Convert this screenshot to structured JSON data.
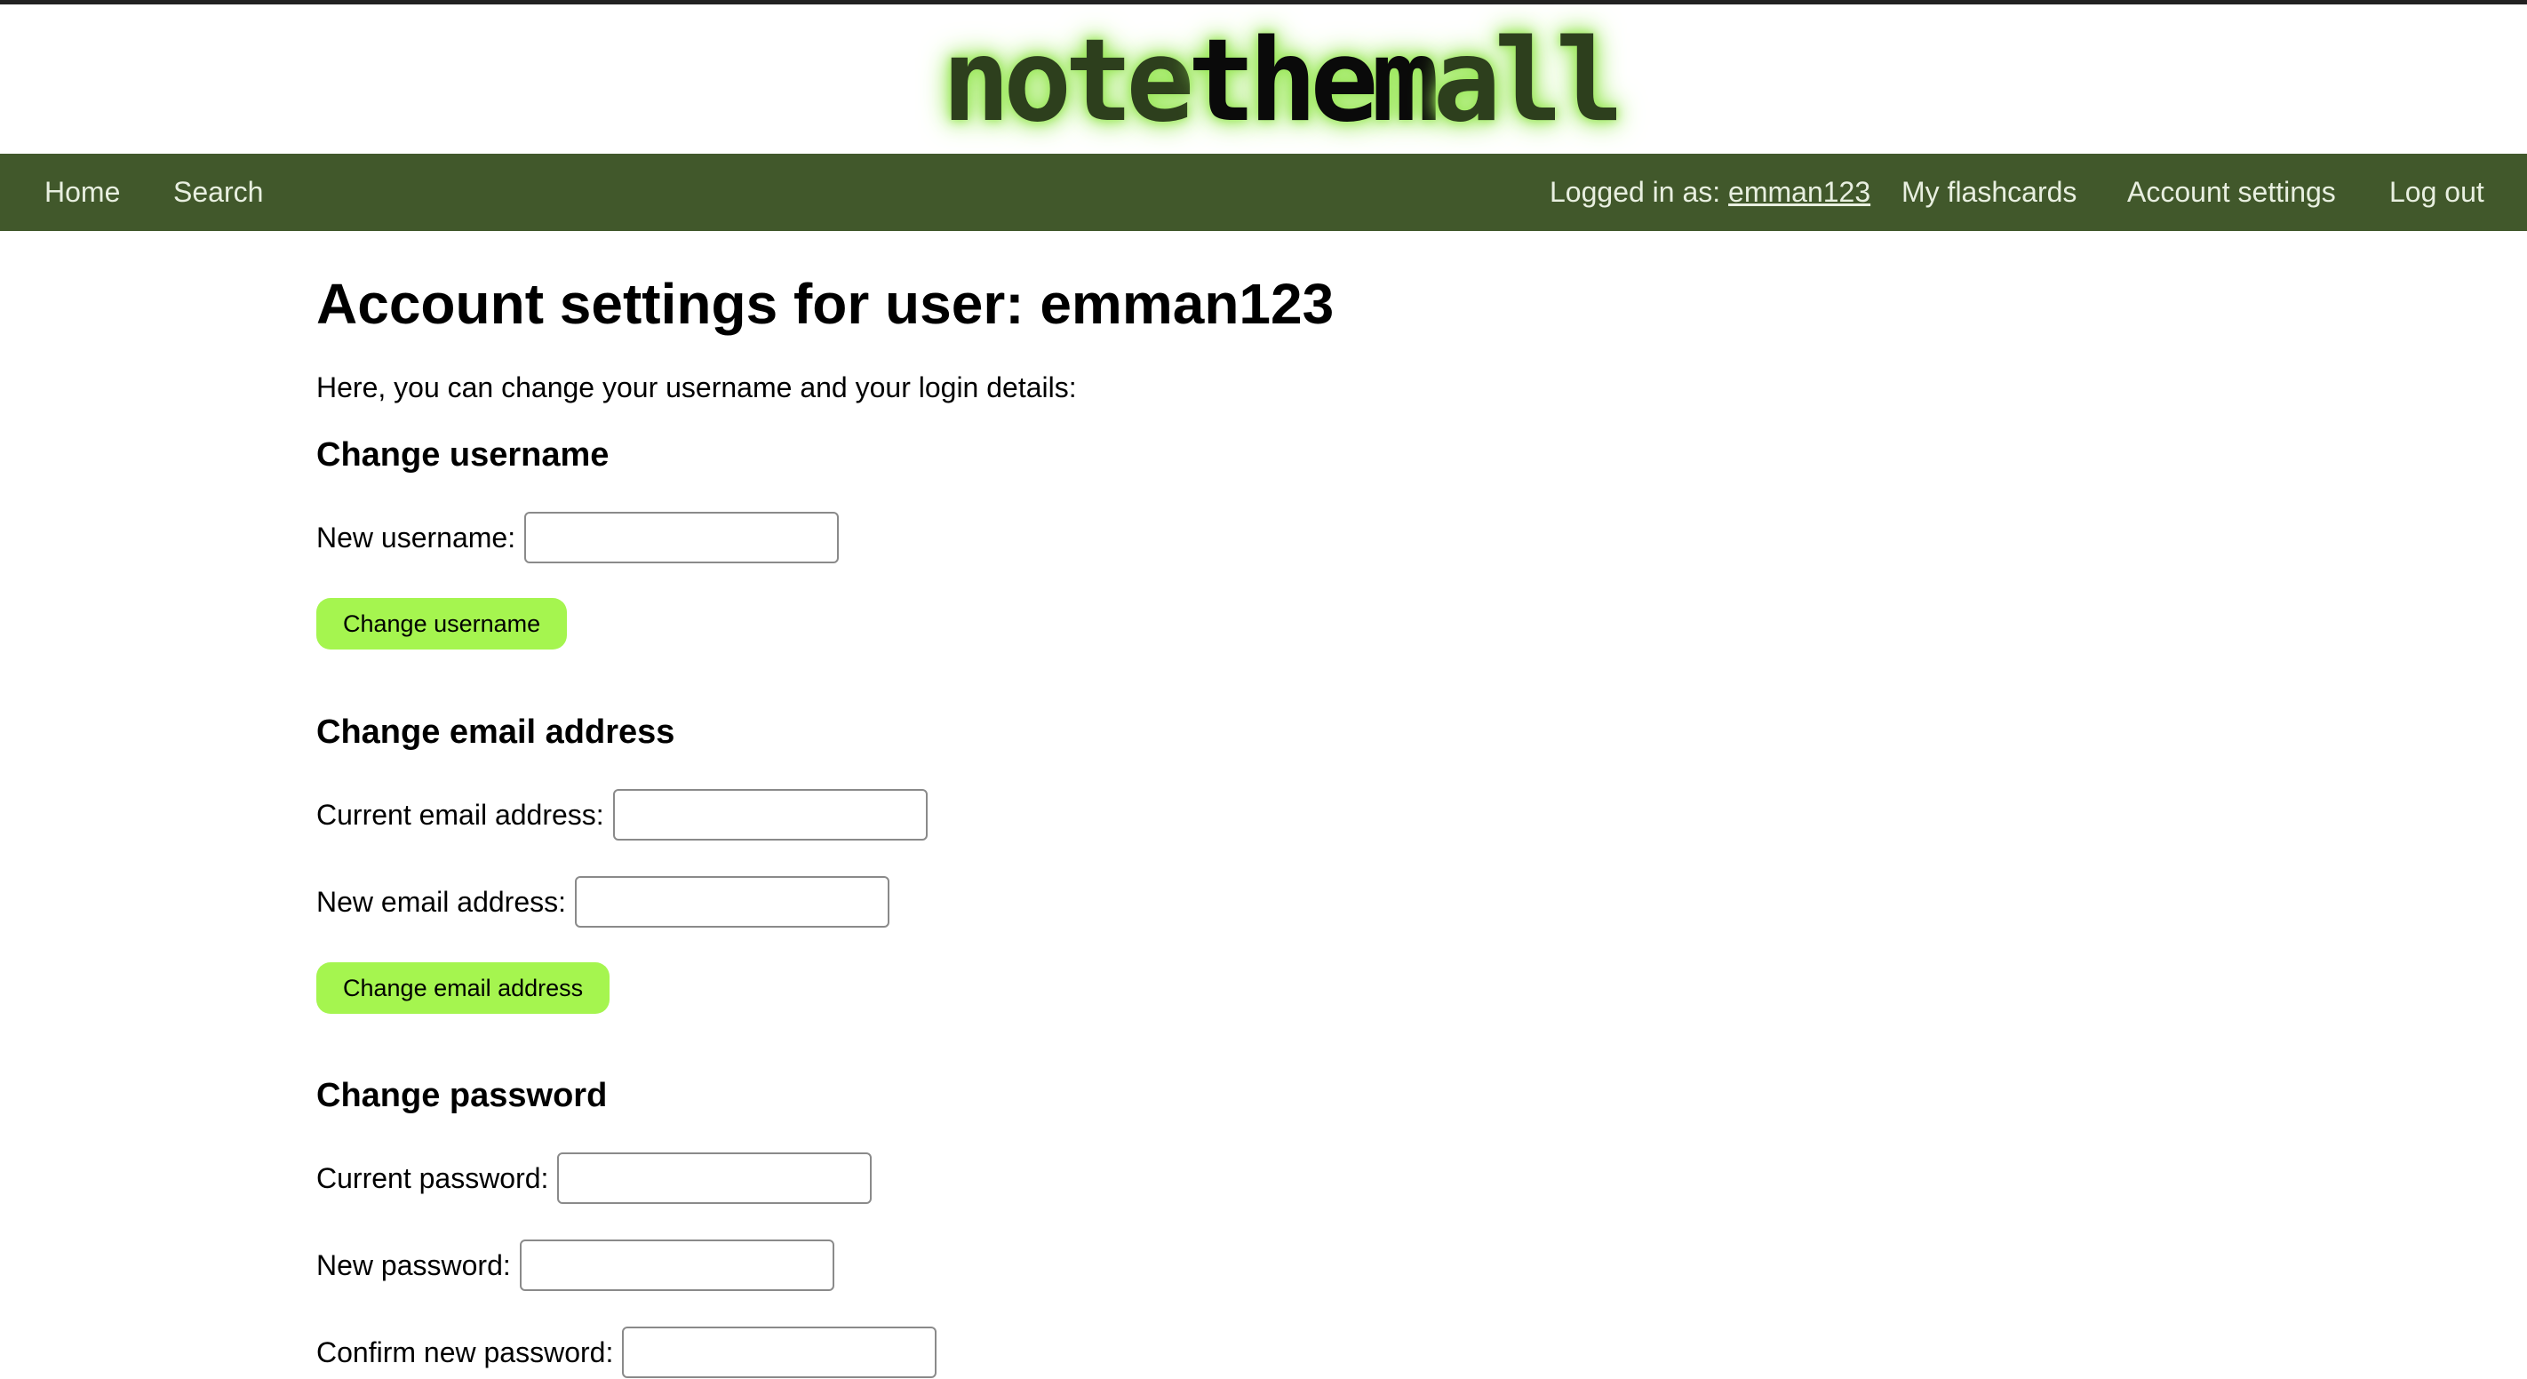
{
  "header": {
    "logo": {
      "part1": "note",
      "part2": "them",
      "part3": "all"
    }
  },
  "nav": {
    "home": "Home",
    "search": "Search",
    "logged_in_prefix": "Logged in as:",
    "username": "emman123",
    "my_flashcards": "My flashcards",
    "account_settings": "Account settings",
    "log_out": "Log out"
  },
  "main": {
    "title": "Account settings for user: emman123",
    "intro": "Here, you can change your username and your login details:",
    "username_section": {
      "heading": "Change username",
      "new_username_label": "New username:",
      "new_username_value": "",
      "button": "Change username"
    },
    "email_section": {
      "heading": "Change email address",
      "current_email_label": "Current email address:",
      "current_email_value": "",
      "new_email_label": "New email address:",
      "new_email_value": "",
      "button": "Change email address"
    },
    "password_section": {
      "heading": "Change password",
      "current_password_label": "Current password:",
      "new_password_label": "New password:",
      "confirm_password_label": "Confirm new password:"
    }
  },
  "colors": {
    "navbar": "#41582b",
    "button": "#a5f54f",
    "logo_glow": "#9be85a"
  }
}
